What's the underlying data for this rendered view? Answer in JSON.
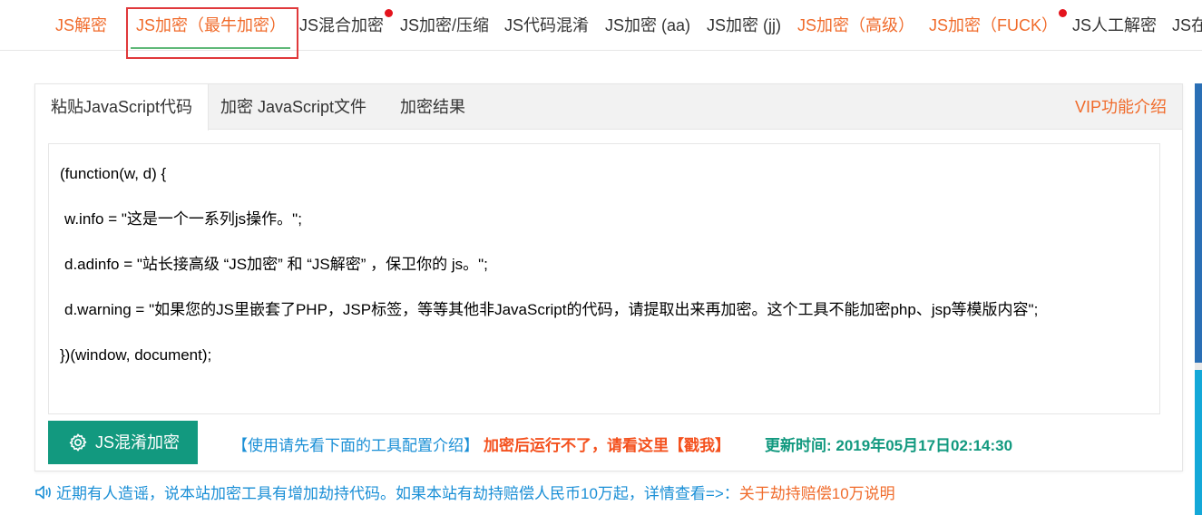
{
  "nav": {
    "items": [
      {
        "label": "JS解密",
        "style": "orange",
        "dot": false
      },
      {
        "label": "JS加密（最牛加密）",
        "style": "orange",
        "dot": false,
        "active": true
      },
      {
        "label": "JS混合加密",
        "style": "normal",
        "dot": true
      },
      {
        "label": "JS加密/压缩",
        "style": "normal",
        "dot": false
      },
      {
        "label": "JS代码混淆",
        "style": "normal",
        "dot": false
      },
      {
        "label": "JS加密 (aa)",
        "style": "normal",
        "dot": false
      },
      {
        "label": "JS加密 (jj)",
        "style": "normal",
        "dot": false
      },
      {
        "label": "JS加密（高级）",
        "style": "orange",
        "dot": false
      },
      {
        "label": "JS加密（FUCK）",
        "style": "orange",
        "dot": true
      },
      {
        "label": "JS人工解密",
        "style": "normal",
        "dot": false
      },
      {
        "label": "JS在",
        "style": "normal",
        "dot": false
      }
    ]
  },
  "tabs": {
    "paste": "粘贴JavaScript代码",
    "file": "加密 JavaScript文件",
    "result": "加密结果",
    "vip": "VIP功能介绍"
  },
  "editor": {
    "lines": [
      "(function(w, d) {",
      " w.info = \"这是一个一系列js操作。\";",
      " d.adinfo = \"站长接高级 “JS加密” 和 “JS解密” ，保卫你的 js。\";",
      " d.warning = \"如果您的JS里嵌套了PHP，JSP标签，等等其他非JavaScript的代码，请提取出来再加密。这个工具不能加密php、jsp等模版内容\";",
      "})(window, document);"
    ]
  },
  "actions": {
    "encrypt_button": "JS混淆加密",
    "help_link": "【使用请先看下面的工具配置介绍】",
    "warn_link": "加密后运行不了，请看这里【戳我】",
    "update_time": "更新时间: 2019年05月17日02:14:30"
  },
  "notice": {
    "text": "近期有人造谣，说本站加密工具有增加劫持代码。如果本站有劫持赔偿人民币10万起，详情查看=>：",
    "link": "关于劫持赔偿10万说明"
  },
  "colors": {
    "orange": "#f06b2b",
    "green": "#12997f",
    "blue": "#1a8fd6",
    "red_dot": "#e4141d",
    "active_underline": "#5fb878"
  },
  "icons": {
    "encrypt_button_icon": "gear-icon",
    "notice_icon": "speaker-icon"
  }
}
